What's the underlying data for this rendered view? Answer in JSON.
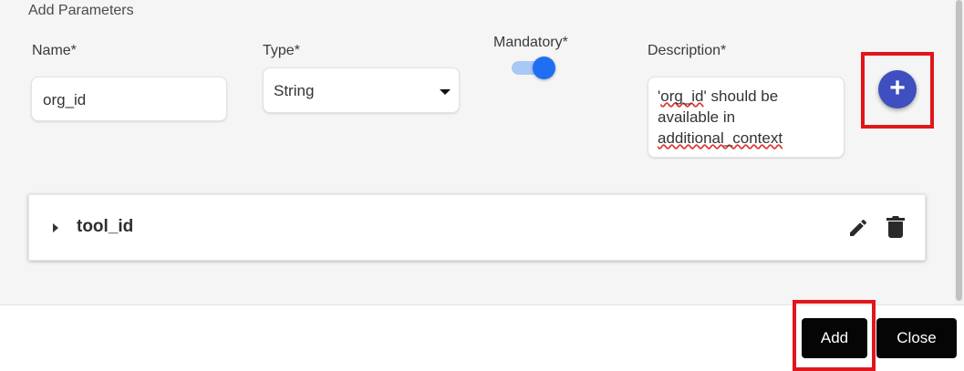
{
  "dialog": {
    "section_title": "Add Parameters",
    "fields": {
      "name_label": "Name*",
      "name_value": "org_id",
      "type_label": "Type*",
      "type_value": "String",
      "mandatory_label": "Mandatory*",
      "mandatory_on": true,
      "description_label": "Description*",
      "description_parts": [
        "'",
        "org_id",
        "' should be available in ",
        "additional_context"
      ]
    },
    "add_parameter_icon": "plus-icon",
    "parameters": [
      {
        "name": "tool_id",
        "expand_icon": "caret-right-icon",
        "edit_icon": "pencil-icon",
        "delete_icon": "trash-icon"
      }
    ],
    "footer": {
      "add_label": "Add",
      "close_label": "Close"
    }
  },
  "colors": {
    "panel_bg": "#f5f5f5",
    "toggle_on": "#1e6ff2",
    "toggle_track": "#a8c8f5",
    "add_param_button": "#3f4fbf",
    "highlight": "#e0161c",
    "footer_button": "#050505"
  }
}
